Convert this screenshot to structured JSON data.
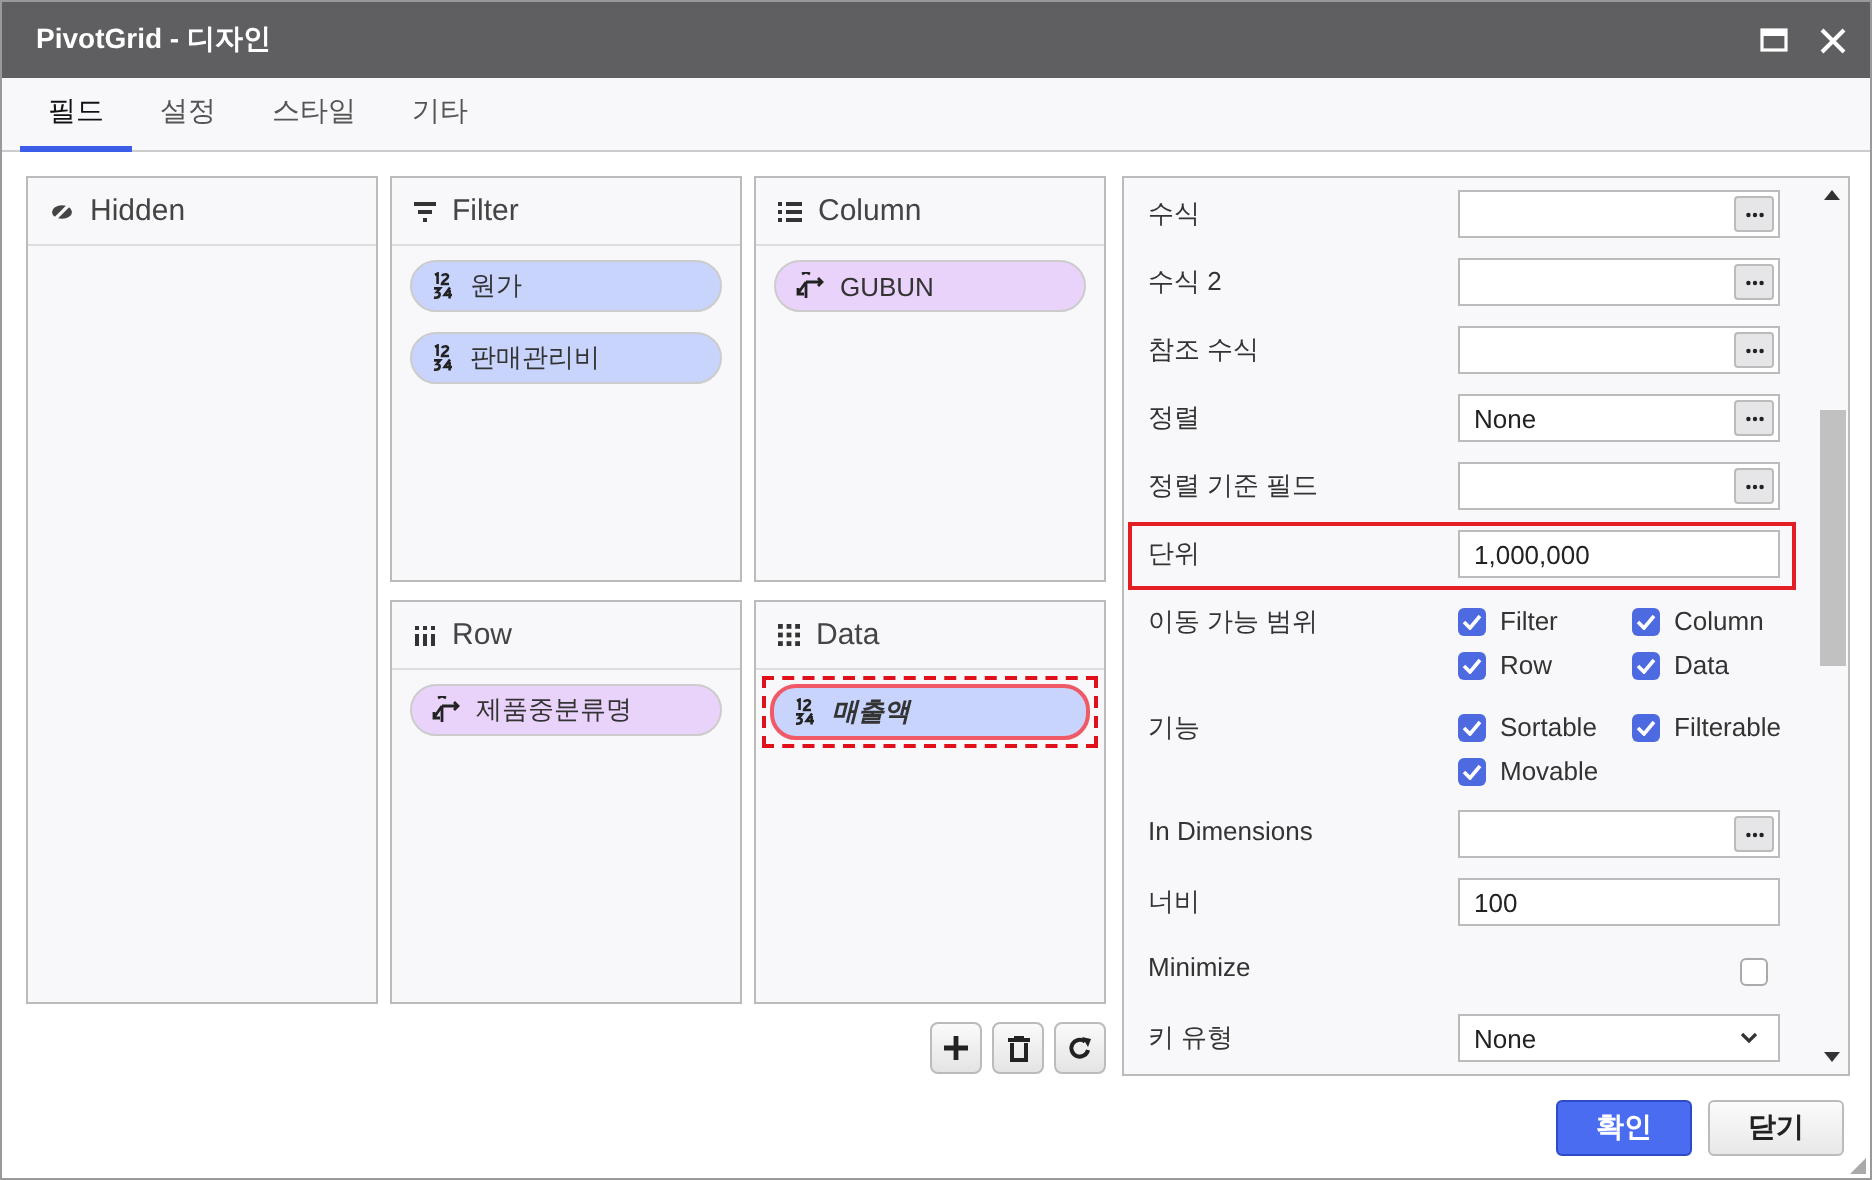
{
  "window": {
    "title": "PivotGrid - 디자인"
  },
  "tabs": [
    {
      "label": "필드",
      "selected": true
    },
    {
      "label": "설정",
      "selected": false
    },
    {
      "label": "스타일",
      "selected": false
    },
    {
      "label": "기타",
      "selected": false
    }
  ],
  "zones": [
    {
      "kind": "hidden",
      "title": "Hidden"
    },
    {
      "kind": "filter",
      "title": "Filter",
      "fields": [
        {
          "kind": "number",
          "label": "원가",
          "selected": false
        },
        {
          "kind": "number",
          "label": "판매관리비",
          "selected": false
        }
      ]
    },
    {
      "kind": "column",
      "title": "Column",
      "fields": [
        {
          "kind": "dimension",
          "label": "GUBUN",
          "selected": false
        }
      ]
    },
    {
      "kind": "row",
      "title": "Row",
      "fields": [
        {
          "kind": "dimension",
          "label": "제품중분류명",
          "selected": false
        }
      ]
    },
    {
      "kind": "data",
      "title": "Data",
      "fields": [
        {
          "kind": "number",
          "label": "매출액",
          "selected": true
        }
      ]
    }
  ],
  "zone_tools": [
    {
      "kind": "add"
    },
    {
      "kind": "delete"
    },
    {
      "kind": "refresh"
    }
  ],
  "properties": [
    {
      "kind": "button-field",
      "label": "수식",
      "highlighted": false
    },
    {
      "kind": "button-field",
      "label": "수식 2",
      "highlighted": false
    },
    {
      "kind": "button-field",
      "label": "참조 수식",
      "highlighted": false
    },
    {
      "kind": "button-field",
      "label": "정렬",
      "value": "None",
      "highlighted": false
    },
    {
      "kind": "button-field",
      "label": "정렬 기준 필드",
      "highlighted": false
    },
    {
      "kind": "text-field",
      "label": "단위",
      "value": "1,000,000",
      "highlighted": true
    },
    {
      "kind": "checks",
      "label": "이동 가능 범위",
      "highlighted": false,
      "options": [
        {
          "label": "Filter",
          "checked": true
        },
        {
          "label": "Column",
          "checked": true
        },
        {
          "label": "Row",
          "checked": true
        },
        {
          "label": "Data",
          "checked": true
        }
      ]
    },
    {
      "kind": "checks",
      "label": "기능",
      "highlighted": false,
      "options": [
        {
          "label": "Sortable",
          "checked": true
        },
        {
          "label": "Filterable",
          "checked": true
        },
        {
          "label": "Movable",
          "checked": true
        }
      ]
    },
    {
      "kind": "button-field",
      "label": "In Dimensions",
      "highlighted": false
    },
    {
      "kind": "text-field",
      "label": "너비",
      "value": "100",
      "highlighted": false
    },
    {
      "kind": "checkbox",
      "label": "Minimize",
      "checked": false,
      "highlighted": false
    },
    {
      "kind": "select",
      "label": "키 유형",
      "value": "None",
      "highlighted": false
    }
  ],
  "buttons": [
    {
      "label": "확인",
      "primary": true
    },
    {
      "label": "닫기",
      "primary": false
    }
  ]
}
